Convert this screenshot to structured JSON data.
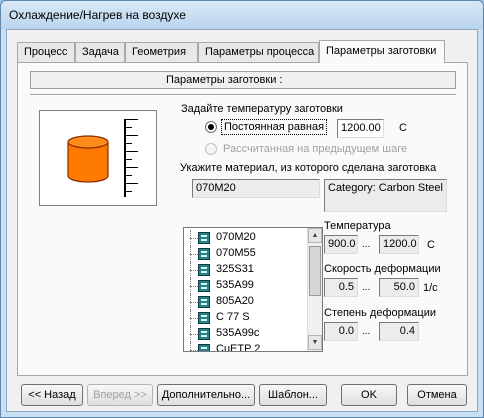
{
  "window": {
    "title": "Охлаждение/Нагрев на воздухе"
  },
  "tabs": [
    {
      "label": "Процесс"
    },
    {
      "label": "Задача"
    },
    {
      "label": "Геометрия"
    },
    {
      "label": "Параметры процесса"
    },
    {
      "label": "Параметры заготовки"
    }
  ],
  "panel": {
    "header": "Параметры заготовки :",
    "temp_prompt": "Задайте температуру заготовки",
    "radio_constant": "Постоянная равная",
    "constant_value": "1200.00",
    "constant_unit": "C",
    "radio_previous": "Рассчитанная на предыдущем шаге",
    "material_prompt": "Укажите материал, из которого сделана заготовка",
    "material_value": "070M20",
    "category": "Category:  Carbon Steel",
    "materials": [
      "070M20",
      "070M55",
      "325S31",
      "535A99",
      "805A20",
      "C 77 S",
      "535A99c",
      "CuETP 2"
    ],
    "temperature_label": "Температура",
    "temp_min": "900.0",
    "temp_max": "1200.0",
    "temp_unit": "C",
    "strain_rate_label": "Скорость деформации",
    "rate_min": "0.5",
    "rate_max": "50.0",
    "rate_unit": "1/c",
    "strain_label": "Степень деформации",
    "strain_min": "0.0",
    "strain_max": "0.4",
    "range_separator": "..."
  },
  "buttons": {
    "back": "<< Назад",
    "next": "Вперед >>",
    "more": "Дополнительно...",
    "template": "Шаблон...",
    "ok": "OK",
    "cancel": "Отмена"
  },
  "colors": {
    "billet": "#ff7a00",
    "billet_outline": "#8a2b00",
    "icon": "#2a7f8a"
  },
  "icons": [
    "billet-cylinder-icon",
    "temperature-scale-icon",
    "material-icon"
  ]
}
